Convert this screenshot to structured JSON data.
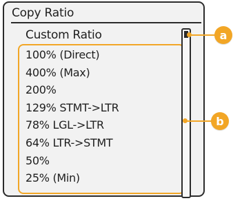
{
  "panel": {
    "title": "Copy Ratio",
    "custom_item": "Custom Ratio",
    "ratio_items": [
      "100% (Direct)",
      "400% (Max)",
      "200%",
      "129% STMT->LTR",
      "78% LGL->LTR",
      "64% LTR->STMT",
      "50%",
      "25% (Min)"
    ]
  },
  "callouts": {
    "a": "a",
    "b": "b"
  },
  "colors": {
    "accent": "#f2a626",
    "frame": "#2b2b2b",
    "panel_bg": "#f2f2f2"
  }
}
